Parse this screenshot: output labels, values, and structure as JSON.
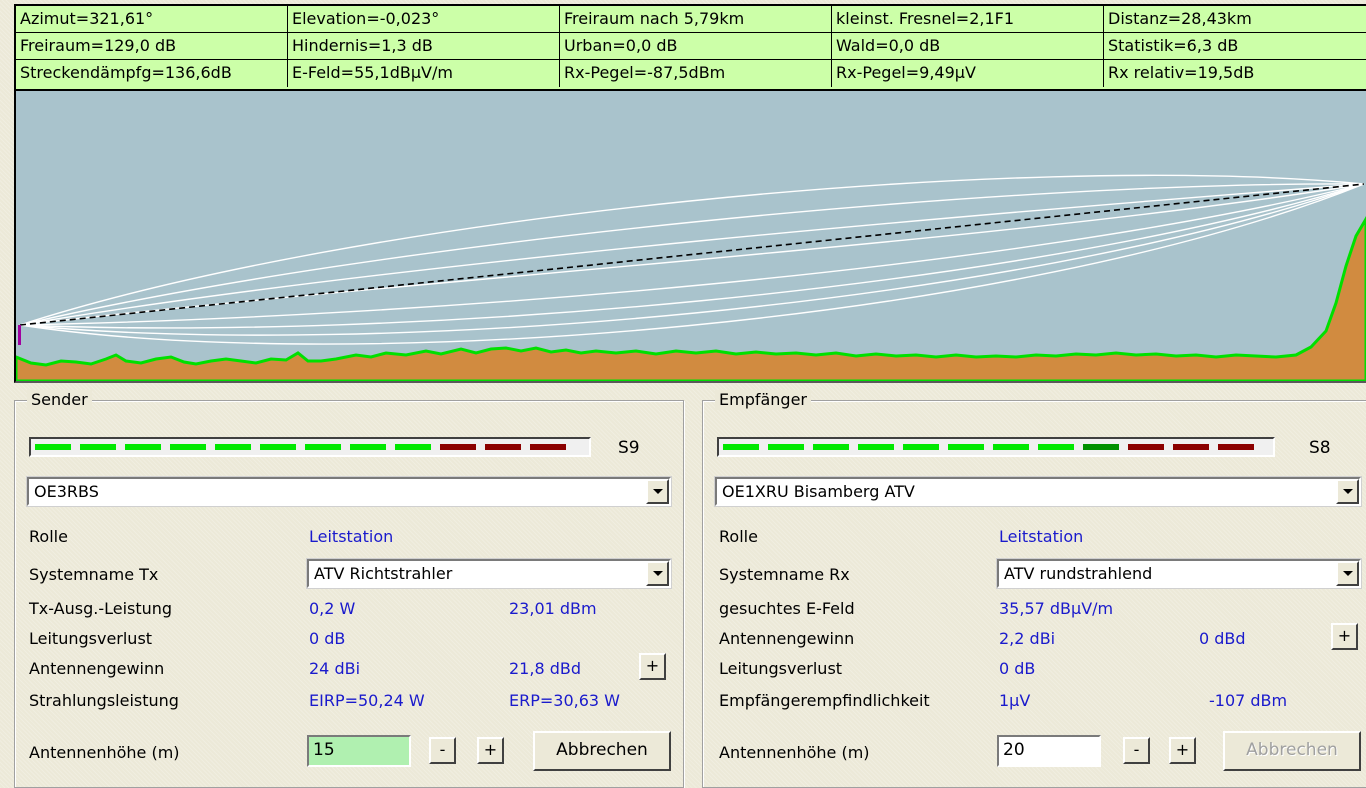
{
  "info": {
    "rows": [
      [
        "Azimut=321,61°",
        "Elevation=-0,023°",
        "Freiraum nach 5,79km",
        "kleinst. Fresnel=2,1F1",
        "Distanz=28,43km"
      ],
      [
        "Freiraum=129,0 dB",
        "Hindernis=1,3 dB",
        "Urban=0,0 dB",
        "Wald=0,0 dB",
        "Statistik=6,3 dB"
      ],
      [
        "Streckendämpfg=136,6dB",
        "E-Feld=55,1dBµV/m",
        "Rx-Pegel=-87,5dBm",
        "Rx-Pegel=9,49µV",
        "Rx relativ=19,5dB"
      ]
    ]
  },
  "colors": {
    "sky": "#a9c3cc",
    "terrain": "#d18b40",
    "terrain_dark": "#a26428",
    "terrain_line": "#00e000",
    "fresnel": "#ffffff",
    "los": "#000000",
    "meter_green": "#00e800",
    "meter_dark_green": "#009000",
    "meter_red": "#8b0000",
    "value_blue": "#1a1acc",
    "tx_height_bg": "#b0f0b0"
  },
  "sender": {
    "title": "Sender",
    "meter": {
      "segments": [
        "g",
        "g",
        "g",
        "g",
        "g",
        "g",
        "g",
        "g",
        "g",
        "r",
        "r",
        "r"
      ],
      "label": "S9"
    },
    "station": "OE3RBS",
    "rolle_label": "Rolle",
    "rolle_value": "Leitstation",
    "system_label": "Systemname Tx",
    "system_value": "ATV Richtstrahler",
    "power_label": "Tx-Ausg.-Leistung",
    "power_w": "0,2 W",
    "power_dbm": "23,01 dBm",
    "loss_label": "Leitungsverlust",
    "loss_value": "0 dB",
    "gain_label": "Antennengewinn",
    "gain_dbi": "24 dBi",
    "gain_dbd": "21,8 dBd",
    "plus_label": "+",
    "radiated_label": "Strahlungsleistung",
    "eirp": "EIRP=50,24 W",
    "erp": "ERP=30,63 W",
    "height_label": "Antennenhöhe (m)",
    "height_value": "15",
    "minus_btn": "-",
    "plus_btn": "+",
    "cancel_btn": "Abbrechen"
  },
  "receiver": {
    "title": "Empfänger",
    "meter": {
      "segments": [
        "g",
        "g",
        "g",
        "g",
        "g",
        "g",
        "g",
        "g",
        "dg",
        "r",
        "r",
        "r"
      ],
      "label": "S8"
    },
    "station": "OE1XRU Bisamberg ATV",
    "rolle_label": "Rolle",
    "rolle_value": "Leitstation",
    "system_label": "Systemname Rx",
    "system_value": "ATV rundstrahlend",
    "field_label": "gesuchtes E-Feld",
    "field_value": "35,57 dBµV/m",
    "gain_label": "Antennengewinn",
    "gain_dbi": "2,2 dBi",
    "gain_dbd": "0 dBd",
    "plus_label": "+",
    "loss_label": "Leitungsverlust",
    "loss_value": "0 dB",
    "sens_label": "Empfängerempfindlichkeit",
    "sens_uv": "1µV",
    "sens_dbm": "-107 dBm",
    "height_label": "Antennenhöhe (m)",
    "height_value": "20",
    "minus_btn": "-",
    "plus_btn": "+",
    "cancel_btn": "Abbrechen"
  }
}
